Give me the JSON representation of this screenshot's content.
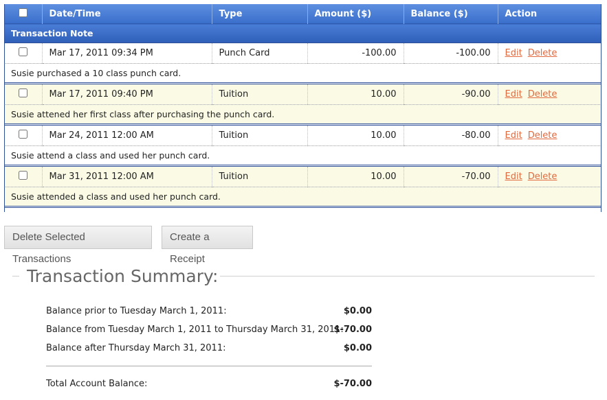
{
  "table": {
    "headers": {
      "date": "Date/Time",
      "type": "Type",
      "amount": "Amount ($)",
      "balance": "Balance ($)",
      "action": "Action"
    },
    "subheader": "Transaction Note",
    "edit_label": "Edit",
    "delete_label": "Delete",
    "rows": [
      {
        "date": "Mar 17, 2011 09:34 PM",
        "type": "Punch Card",
        "amount": "-100.00",
        "balance": "-100.00",
        "note": "Susie purchased a 10 class punch card."
      },
      {
        "date": "Mar 17, 2011 09:40 PM",
        "type": "Tuition",
        "amount": "10.00",
        "balance": "-90.00",
        "note": "Susie attened her first class after purchasing the punch card."
      },
      {
        "date": "Mar 24, 2011 12:00 AM",
        "type": "Tuition",
        "amount": "10.00",
        "balance": "-80.00",
        "note": "Susie attend a class and used her punch card."
      },
      {
        "date": "Mar 31, 2011 12:00 AM",
        "type": "Tuition",
        "amount": "10.00",
        "balance": "-70.00",
        "note": "Susie attended a class and used her punch card."
      }
    ]
  },
  "buttons": {
    "delete_selected": "Delete Selected Transactions",
    "create_receipt": "Create a Receipt"
  },
  "summary": {
    "title": "Transaction Summary:",
    "rows": [
      {
        "label": "Balance prior to Tuesday March 1, 2011:",
        "value": "$0.00"
      },
      {
        "label": "Balance from Tuesday March 1, 2011 to Thursday March 31, 2011:",
        "value": "$-70.00"
      },
      {
        "label": "Balance after Thursday March 31, 2011:",
        "value": "$0.00"
      }
    ],
    "total_label": "Total Account Balance:",
    "total_value": "$-70.00"
  },
  "colors": {
    "header_blue": "#3a6fcb",
    "row_alt": "#fbfbe5",
    "link": "#e06a3e"
  }
}
